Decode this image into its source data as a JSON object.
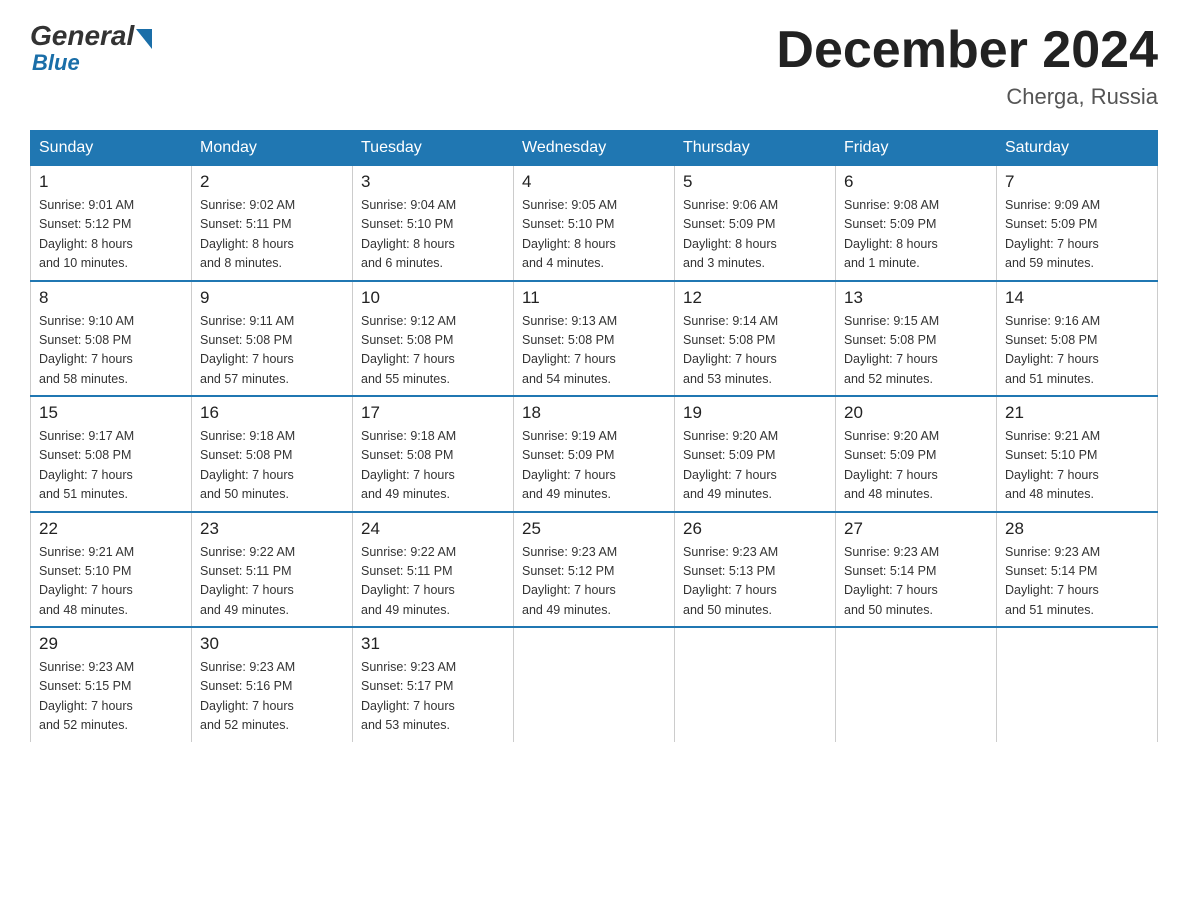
{
  "header": {
    "logo": {
      "general": "General",
      "blue": "Blue"
    },
    "title": "December 2024",
    "subtitle": "Cherga, Russia"
  },
  "weekdays": [
    "Sunday",
    "Monday",
    "Tuesday",
    "Wednesday",
    "Thursday",
    "Friday",
    "Saturday"
  ],
  "weeks": [
    [
      {
        "day": "1",
        "sunrise": "9:01 AM",
        "sunset": "5:12 PM",
        "daylight": "8 hours",
        "daylight2": "and 10 minutes."
      },
      {
        "day": "2",
        "sunrise": "9:02 AM",
        "sunset": "5:11 PM",
        "daylight": "8 hours",
        "daylight2": "and 8 minutes."
      },
      {
        "day": "3",
        "sunrise": "9:04 AM",
        "sunset": "5:10 PM",
        "daylight": "8 hours",
        "daylight2": "and 6 minutes."
      },
      {
        "day": "4",
        "sunrise": "9:05 AM",
        "sunset": "5:10 PM",
        "daylight": "8 hours",
        "daylight2": "and 4 minutes."
      },
      {
        "day": "5",
        "sunrise": "9:06 AM",
        "sunset": "5:09 PM",
        "daylight": "8 hours",
        "daylight2": "and 3 minutes."
      },
      {
        "day": "6",
        "sunrise": "9:08 AM",
        "sunset": "5:09 PM",
        "daylight": "8 hours",
        "daylight2": "and 1 minute."
      },
      {
        "day": "7",
        "sunrise": "9:09 AM",
        "sunset": "5:09 PM",
        "daylight": "7 hours",
        "daylight2": "and 59 minutes."
      }
    ],
    [
      {
        "day": "8",
        "sunrise": "9:10 AM",
        "sunset": "5:08 PM",
        "daylight": "7 hours",
        "daylight2": "and 58 minutes."
      },
      {
        "day": "9",
        "sunrise": "9:11 AM",
        "sunset": "5:08 PM",
        "daylight": "7 hours",
        "daylight2": "and 57 minutes."
      },
      {
        "day": "10",
        "sunrise": "9:12 AM",
        "sunset": "5:08 PM",
        "daylight": "7 hours",
        "daylight2": "and 55 minutes."
      },
      {
        "day": "11",
        "sunrise": "9:13 AM",
        "sunset": "5:08 PM",
        "daylight": "7 hours",
        "daylight2": "and 54 minutes."
      },
      {
        "day": "12",
        "sunrise": "9:14 AM",
        "sunset": "5:08 PM",
        "daylight": "7 hours",
        "daylight2": "and 53 minutes."
      },
      {
        "day": "13",
        "sunrise": "9:15 AM",
        "sunset": "5:08 PM",
        "daylight": "7 hours",
        "daylight2": "and 52 minutes."
      },
      {
        "day": "14",
        "sunrise": "9:16 AM",
        "sunset": "5:08 PM",
        "daylight": "7 hours",
        "daylight2": "and 51 minutes."
      }
    ],
    [
      {
        "day": "15",
        "sunrise": "9:17 AM",
        "sunset": "5:08 PM",
        "daylight": "7 hours",
        "daylight2": "and 51 minutes."
      },
      {
        "day": "16",
        "sunrise": "9:18 AM",
        "sunset": "5:08 PM",
        "daylight": "7 hours",
        "daylight2": "and 50 minutes."
      },
      {
        "day": "17",
        "sunrise": "9:18 AM",
        "sunset": "5:08 PM",
        "daylight": "7 hours",
        "daylight2": "and 49 minutes."
      },
      {
        "day": "18",
        "sunrise": "9:19 AM",
        "sunset": "5:09 PM",
        "daylight": "7 hours",
        "daylight2": "and 49 minutes."
      },
      {
        "day": "19",
        "sunrise": "9:20 AM",
        "sunset": "5:09 PM",
        "daylight": "7 hours",
        "daylight2": "and 49 minutes."
      },
      {
        "day": "20",
        "sunrise": "9:20 AM",
        "sunset": "5:09 PM",
        "daylight": "7 hours",
        "daylight2": "and 48 minutes."
      },
      {
        "day": "21",
        "sunrise": "9:21 AM",
        "sunset": "5:10 PM",
        "daylight": "7 hours",
        "daylight2": "and 48 minutes."
      }
    ],
    [
      {
        "day": "22",
        "sunrise": "9:21 AM",
        "sunset": "5:10 PM",
        "daylight": "7 hours",
        "daylight2": "and 48 minutes."
      },
      {
        "day": "23",
        "sunrise": "9:22 AM",
        "sunset": "5:11 PM",
        "daylight": "7 hours",
        "daylight2": "and 49 minutes."
      },
      {
        "day": "24",
        "sunrise": "9:22 AM",
        "sunset": "5:11 PM",
        "daylight": "7 hours",
        "daylight2": "and 49 minutes."
      },
      {
        "day": "25",
        "sunrise": "9:23 AM",
        "sunset": "5:12 PM",
        "daylight": "7 hours",
        "daylight2": "and 49 minutes."
      },
      {
        "day": "26",
        "sunrise": "9:23 AM",
        "sunset": "5:13 PM",
        "daylight": "7 hours",
        "daylight2": "and 50 minutes."
      },
      {
        "day": "27",
        "sunrise": "9:23 AM",
        "sunset": "5:14 PM",
        "daylight": "7 hours",
        "daylight2": "and 50 minutes."
      },
      {
        "day": "28",
        "sunrise": "9:23 AM",
        "sunset": "5:14 PM",
        "daylight": "7 hours",
        "daylight2": "and 51 minutes."
      }
    ],
    [
      {
        "day": "29",
        "sunrise": "9:23 AM",
        "sunset": "5:15 PM",
        "daylight": "7 hours",
        "daylight2": "and 52 minutes."
      },
      {
        "day": "30",
        "sunrise": "9:23 AM",
        "sunset": "5:16 PM",
        "daylight": "7 hours",
        "daylight2": "and 52 minutes."
      },
      {
        "day": "31",
        "sunrise": "9:23 AM",
        "sunset": "5:17 PM",
        "daylight": "7 hours",
        "daylight2": "and 53 minutes."
      },
      null,
      null,
      null,
      null
    ]
  ],
  "labels": {
    "sunrise_prefix": "Sunrise: ",
    "sunset_prefix": "Sunset: ",
    "daylight_prefix": "Daylight: "
  }
}
